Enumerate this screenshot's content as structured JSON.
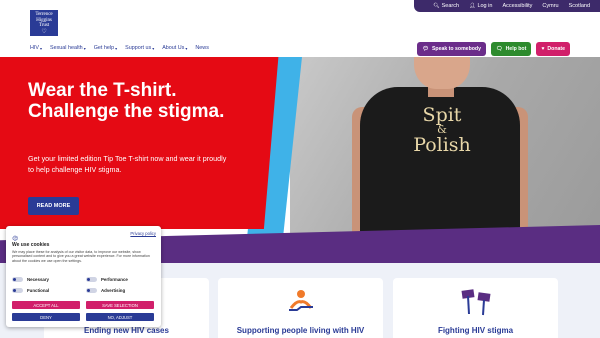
{
  "utility_bar": {
    "search": "Search",
    "login": "Log in",
    "accessibility": "Accessibility",
    "cymru": "Cymru",
    "scotland": "Scotland"
  },
  "logo": {
    "line1": "Terrence",
    "line2": "Higgins",
    "line3": "Trust"
  },
  "nav": [
    "HIV",
    "Sexual health",
    "Get help",
    "Support us",
    "About Us",
    "News"
  ],
  "actions": {
    "speak": "Speak to somebody",
    "bot": "Help bot",
    "donate": "Donate"
  },
  "hero": {
    "title": "Wear the T-shirt. Challenge the stigma.",
    "text": "Get your limited edition Tip Toe T-shirt now and wear it proudly to help challenge HIV stigma.",
    "button": "READ MORE",
    "shirt_line1": "Spit",
    "shirt_amp": "&",
    "shirt_line2": "Polish"
  },
  "cards": [
    {
      "title": "Ending new HIV cases"
    },
    {
      "title": "Supporting people living with HIV"
    },
    {
      "title": "Fighting HIV stigma"
    }
  ],
  "cookie": {
    "privacy": "Privacy policy",
    "title": "We use cookies",
    "description": "We may place these for analysis of our visitor data, to improve our website, show personalised content and to give you a great website experience. For more information about the cookies we use open the settings.",
    "toggles": [
      "Necessary",
      "Performance",
      "Functional",
      "Advertising"
    ],
    "accept_all": "ACCEPT ALL",
    "save_selection": "SAVE SELECTION",
    "deny": "DENY",
    "no_adjust": "NO, ADJUST"
  },
  "colors": {
    "brand_blue": "#2a3b96",
    "hero_red": "#e50a14",
    "purple": "#5a2d82",
    "accent_blue": "#3fb2e8",
    "donate_pink": "#d11f6a"
  }
}
